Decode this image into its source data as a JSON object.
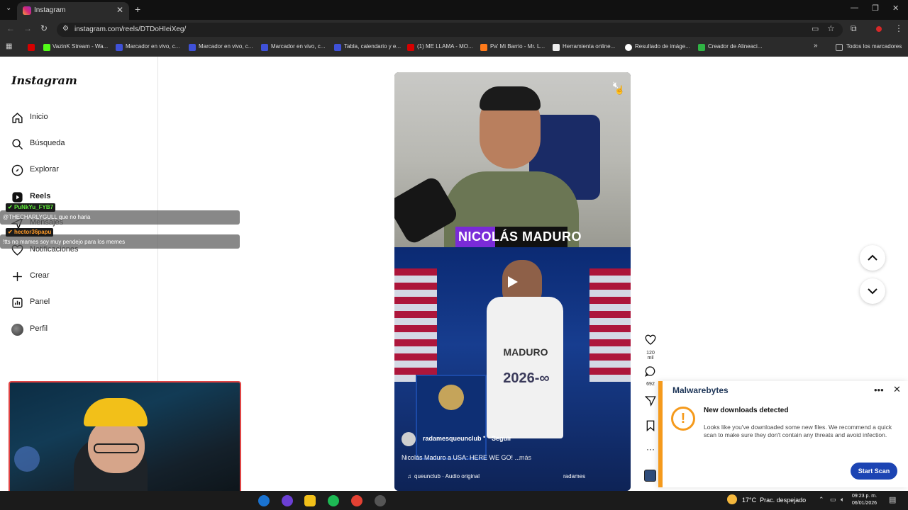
{
  "browser": {
    "tab_title": "Instagram",
    "url": "instagram.com/reels/DTDoHIeiXeg/",
    "bookmarks": [
      "VazinK Stream - Wa...",
      "Marcador en vivo, c...",
      "Marcador en vivo, c...",
      "Marcador en vivo, c...",
      "Tabla, calendario y e...",
      "(1) ME LLAMA - MO...",
      "Pa' Mi Barrio - Mr. L...",
      "Herramienta online...",
      "Resultado de imáge...",
      "Creador de Alineaci..."
    ],
    "all_bookmarks": "Todos los marcadores"
  },
  "sidebar": {
    "logo": "Instagram",
    "items": [
      {
        "label": "Inicio"
      },
      {
        "label": "Búsqueda"
      },
      {
        "label": "Explorar"
      },
      {
        "label": "Reels"
      },
      {
        "label": "Mensajes"
      },
      {
        "label": "Notificaciones"
      },
      {
        "label": "Crear"
      },
      {
        "label": "Panel"
      },
      {
        "label": "Perfil"
      }
    ]
  },
  "chat": [
    {
      "user": "PuNkYu_FYB7",
      "message": "@THECHARLYGULL que no haria"
    },
    {
      "user": "hector36papu",
      "message": "!tts no mames soy muy pendejo para los memes"
    }
  ],
  "reel": {
    "caption_overlay": "NICOLÁS MADURO",
    "jersey_name": "MADURO",
    "jersey_number": "2026-∞",
    "account": "radamesqueunclub",
    "follow": "Seguir",
    "description": "Nicolás Maduro a USA: HERE WE GO! ...",
    "more": "más",
    "audio": "queunclub · Audio original",
    "audio_right": "radames"
  },
  "actions": {
    "likes": "120 mil",
    "comments": "692"
  },
  "malwarebytes": {
    "brand": "Malwarebytes",
    "title": "New downloads detected",
    "body": "Looks like you've downloaded some new files. We recommend a quick scan to make sure they don't contain any threats and avoid infection.",
    "button": "Start Scan"
  },
  "taskbar": {
    "weather": "17°C  Prac. despejado",
    "time": "09:23 p. m.",
    "date": "06/01/2026"
  }
}
